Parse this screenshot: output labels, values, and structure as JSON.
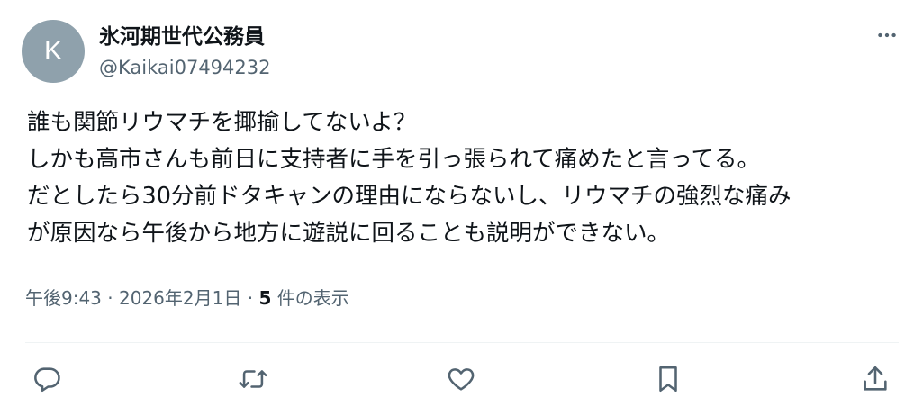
{
  "author": {
    "avatar_letter": "K",
    "display_name": "氷河期世代公務員",
    "handle": "@Kaikai07494232"
  },
  "post": {
    "lines": [
      "誰も関節リウマチを揶揄してないよ？",
      "しかも高市さんも前日に支持者に手を引っ張られて痛めたと言ってる。",
      "だとしたら30分前ドタキャンの理由にならないし、リウマチの強烈な痛み",
      "が原因なら午後から地方に遊説に回ることも説明ができない。"
    ]
  },
  "meta": {
    "time": "午後9:43",
    "separator1": " · ",
    "date": "2026年2月1日",
    "separator2": " · ",
    "view_count": "5",
    "view_suffix": " 件の表示"
  },
  "actions": {
    "reply_icon": "reply-icon",
    "repost_icon": "repost-icon",
    "like_icon": "heart-icon",
    "bookmark_icon": "bookmark-icon",
    "share_icon": "share-icon"
  },
  "colors": {
    "text_primary": "#0f1419",
    "text_secondary": "#536471",
    "avatar_bg": "#8fa1ac",
    "divider": "#eff3f4"
  }
}
